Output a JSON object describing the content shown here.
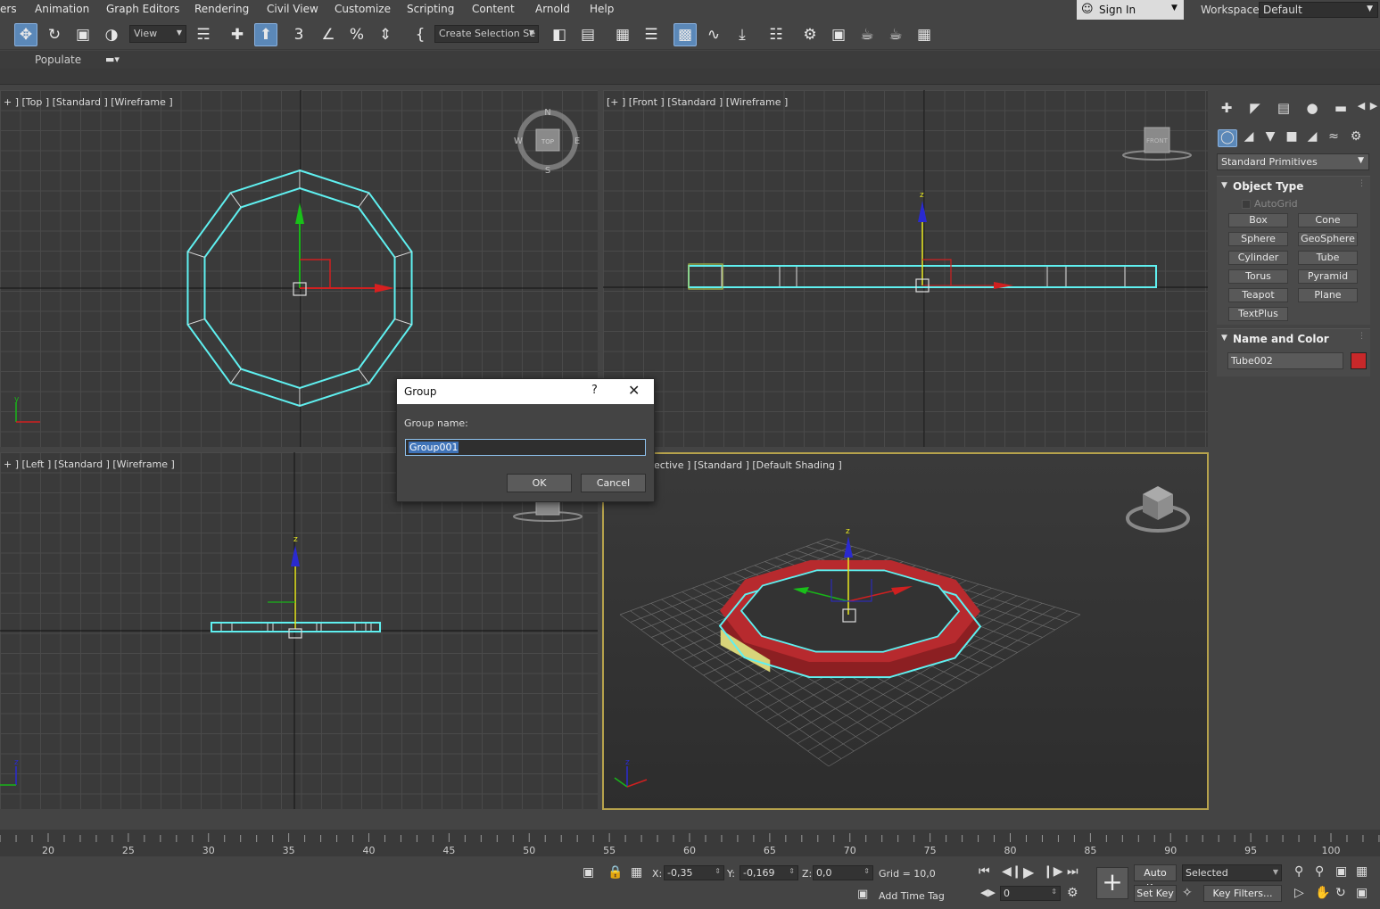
{
  "menubar": {
    "items": [
      "ers",
      "Animation",
      "Graph Editors",
      "Rendering",
      "Civil View",
      "Customize",
      "Scripting",
      "Content",
      "Arnold",
      "Help"
    ],
    "sign_in": "Sign In",
    "workspaces_label": "Workspaces:",
    "workspace_value": "Default"
  },
  "toolbar": {
    "view_dropdown": "View",
    "selection_set": "Create Selection Se"
  },
  "ribbon": {
    "populate": "Populate"
  },
  "viewports": {
    "top": {
      "label": "+ ] [Top ] [Standard ] [Wireframe ]",
      "cube": "TOP",
      "compass": [
        "N",
        "S",
        "W",
        "E"
      ]
    },
    "front": {
      "label": "[+ ] [Front ] [Standard ] [Wireframe ]",
      "cube": "FRONT"
    },
    "left": {
      "label": "+ ] [Left ] [Standard ] [Wireframe ]"
    },
    "perspective": {
      "label": "ective ] [Standard ] [Default Shading ]"
    },
    "axis": {
      "x": "x",
      "y": "y",
      "z": "z"
    }
  },
  "command_panel": {
    "category": "Standard Primitives",
    "object_type": {
      "title": "Object Type",
      "autogrid": "AutoGrid",
      "buttons": [
        "Box",
        "Cone",
        "Sphere",
        "GeoSphere",
        "Cylinder",
        "Tube",
        "Torus",
        "Pyramid",
        "Teapot",
        "Plane",
        "TextPlus"
      ]
    },
    "name_and_color": {
      "title": "Name and Color",
      "name": "Tube002",
      "color": "#c8282a"
    }
  },
  "dialog": {
    "title": "Group",
    "help": "?",
    "label": "Group name:",
    "value": "Group001",
    "ok": "OK",
    "cancel": "Cancel"
  },
  "timeline": {
    "ticks": [
      "20",
      "25",
      "30",
      "35",
      "40",
      "45",
      "50",
      "55",
      "60",
      "65",
      "70",
      "75",
      "80",
      "85",
      "90",
      "95",
      "100"
    ]
  },
  "status": {
    "x_label": "X:",
    "x_value": "-0,35",
    "y_label": "Y:",
    "y_value": "-0,169",
    "z_label": "Z:",
    "z_value": "0,0",
    "grid": "Grid = 10,0",
    "add_time_tag": "Add Time Tag",
    "frame": "0",
    "auto_key": "Auto Key",
    "set_key": "Set Key",
    "key_mode": "Selected",
    "key_filters": "Key Filters..."
  },
  "colors": {
    "selection_outline": "#5ff0f0",
    "tube_red": "#b72a2e",
    "tube_yellow": "#d8d47a",
    "active_viewport_border": "#b6a24c"
  }
}
